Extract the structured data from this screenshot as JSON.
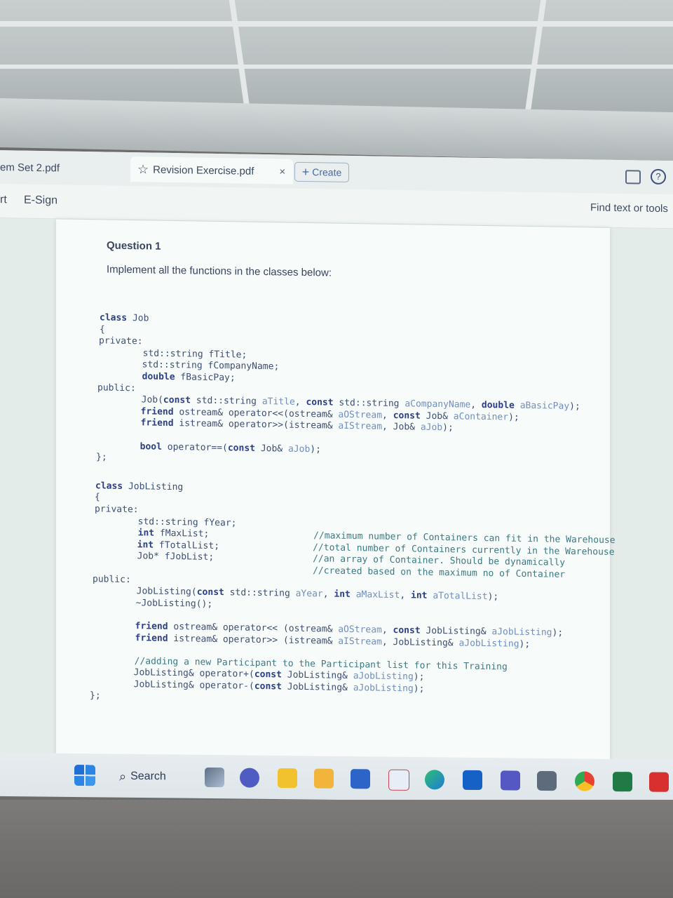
{
  "browser": {
    "tabs": [
      {
        "label": "em Set 2.pdf"
      },
      {
        "label": "Revision Exercise.pdf",
        "active": true
      },
      {
        "label": "Create"
      }
    ],
    "toolbar_left_partial": "rt",
    "toolbar_esign": "E-Sign",
    "find_label": "Find text or tools"
  },
  "document": {
    "question_title": "Question 1",
    "instruction": "Implement all the functions in the classes below:",
    "code_lines": [
      "class Job",
      "{",
      "private:",
      "        std::string fTitle;",
      "        std::string fCompanyName;",
      "        double fBasicPay;",
      "public:",
      "        Job(const std::string aTitle, const std::string aCompanyName, double aBasicPay);",
      "        friend ostream& operator<<(ostream& aOStream, const Job& aContainer);",
      "        friend istream& operator>>(istream& aIStream, Job& aJob);",
      "",
      "        bool operator==(const Job& aJob);",
      "};",
      "",
      "class JobListing",
      "{",
      "private:",
      "        std::string fYear;",
      "        int fMaxList;                   //maximum number of Containers can fit in the Warehouse",
      "        int fTotalList;                 //total number of Containers currently in the Warehouse",
      "        Job* fJobList;                  //an array of Container. Should be dynamically",
      "                                        //created based on the maximum no of Container",
      "public:",
      "        JobListing(const std::string aYear, int aMaxList, int aTotalList);",
      "        ~JobListing();",
      "",
      "        friend ostream& operator<< (ostream& aOStream, const JobListing& aJobListing);",
      "        friend istream& operator>> (istream& aIStream, JobListing& aJobListing);",
      "",
      "        //adding a new Participant to the Participant list for this Training",
      "        JobListing& operator+(const JobListing& aJobListing);",
      "        JobListing& operator-(const JobListing& aJobListing);",
      "};"
    ]
  },
  "taskbar": {
    "search_label": "Search",
    "icons": [
      "windows-start-icon",
      "task-view-icon",
      "meet-icon",
      "sticky-notes-icon",
      "file-explorer-icon",
      "whiteboard-icon",
      "snipping-icon",
      "edge-icon",
      "outlook-icon",
      "teams-icon",
      "camera-icon",
      "chrome-icon",
      "excel-icon",
      "acrobat-icon"
    ]
  }
}
